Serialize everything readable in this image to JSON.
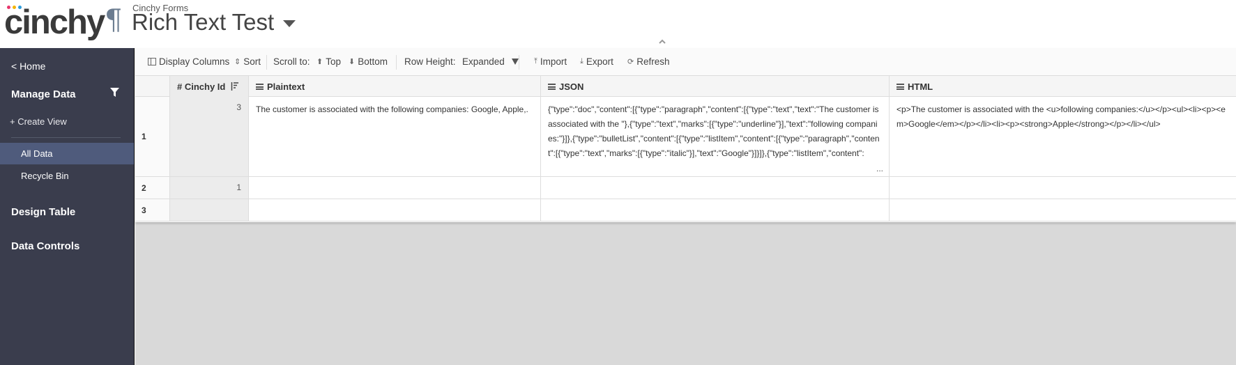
{
  "header": {
    "logo_text": "cinchy",
    "logo_dot_colors": [
      "#e8356b",
      "#f4b400",
      "#2d9cdb"
    ],
    "app_subtitle": "Cinchy Forms",
    "app_title": "Rich Text Test",
    "title_icon": "pilcrow-icon"
  },
  "sidebar": {
    "home": "< Home",
    "manage_data": "Manage Data",
    "create_view": "+ Create View",
    "views": [
      "All Data",
      "Recycle Bin"
    ],
    "selected_view": "All Data",
    "design_table": "Design Table",
    "data_controls": "Data Controls",
    "bg_color": "#3a3d4d",
    "selected_color": "#4f5b7c"
  },
  "toolbar": {
    "display_columns": "Display Columns",
    "sort": "Sort",
    "scroll_to": "Scroll to:",
    "top": "Top",
    "bottom": "Bottom",
    "row_height_label": "Row Height:",
    "row_height_value": "Expanded",
    "import": "Import",
    "export": "Export",
    "refresh": "Refresh"
  },
  "table": {
    "columns": [
      "# Cinchy Id",
      "Plaintext",
      "JSON",
      "HTML"
    ],
    "rows": [
      {
        "num": "1",
        "id": "3",
        "plaintext": "The customer is associated with the following companies: Google, Apple,.",
        "json": "{\"type\":\"doc\",\"content\":[{\"type\":\"paragraph\",\"content\":[{\"type\":\"text\",\"text\":\"The customer is associated with the \"},{\"type\":\"text\",\"marks\":[{\"type\":\"underline\"}],\"text\":\"following companies:\"}]},{\"type\":\"bulletList\",\"content\":[{\"type\":\"listItem\",\"content\":[{\"type\":\"paragraph\",\"content\":[{\"type\":\"text\",\"marks\":[{\"type\":\"italic\"}],\"text\":\"Google\"}]}]},{\"type\":\"listItem\",\"content\":",
        "json_more": "...",
        "html": "<p>The customer is associated with the <u>following companies:</u></p><ul><li><p><em>Google</em></p></li><li><p><strong>Apple</strong></p></li></ul>"
      },
      {
        "num": "2",
        "id": "1",
        "plaintext": "",
        "json": "",
        "json_more": "",
        "html": ""
      },
      {
        "num": "3",
        "id": "",
        "plaintext": "",
        "json": "",
        "json_more": "",
        "html": ""
      }
    ]
  }
}
